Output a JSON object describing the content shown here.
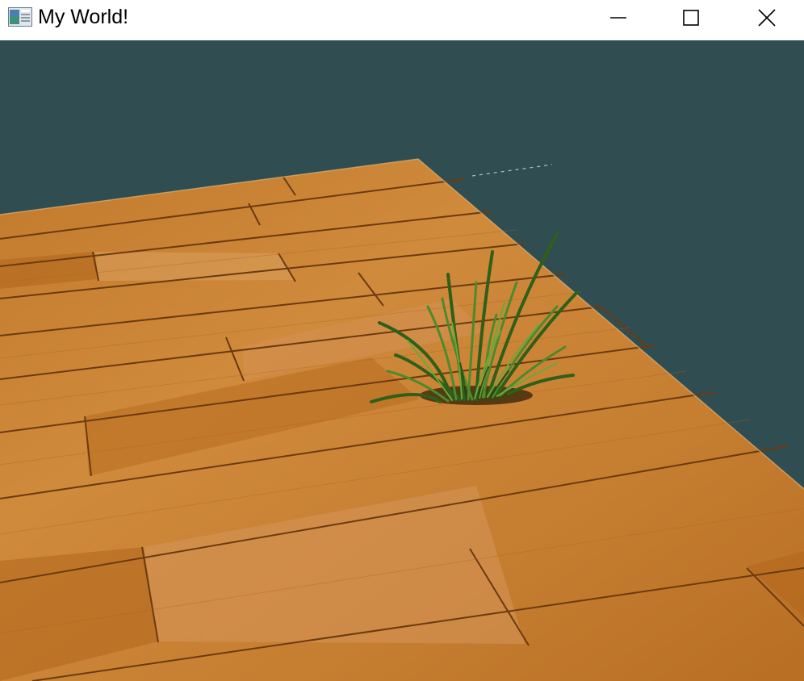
{
  "window": {
    "title": "My World!",
    "icon": "app-window-icon",
    "controls": {
      "minimize_icon": "minimize-icon",
      "maximize_icon": "maximize-icon",
      "close_icon": "close-icon"
    }
  },
  "scene": {
    "background_color": "#304e51",
    "floor_texture": "wooden-planks",
    "floor_color": "#c98436",
    "floor_seam_color": "#6b3a10",
    "object": "grass-tuft",
    "grass_color": "#3f7a22"
  }
}
